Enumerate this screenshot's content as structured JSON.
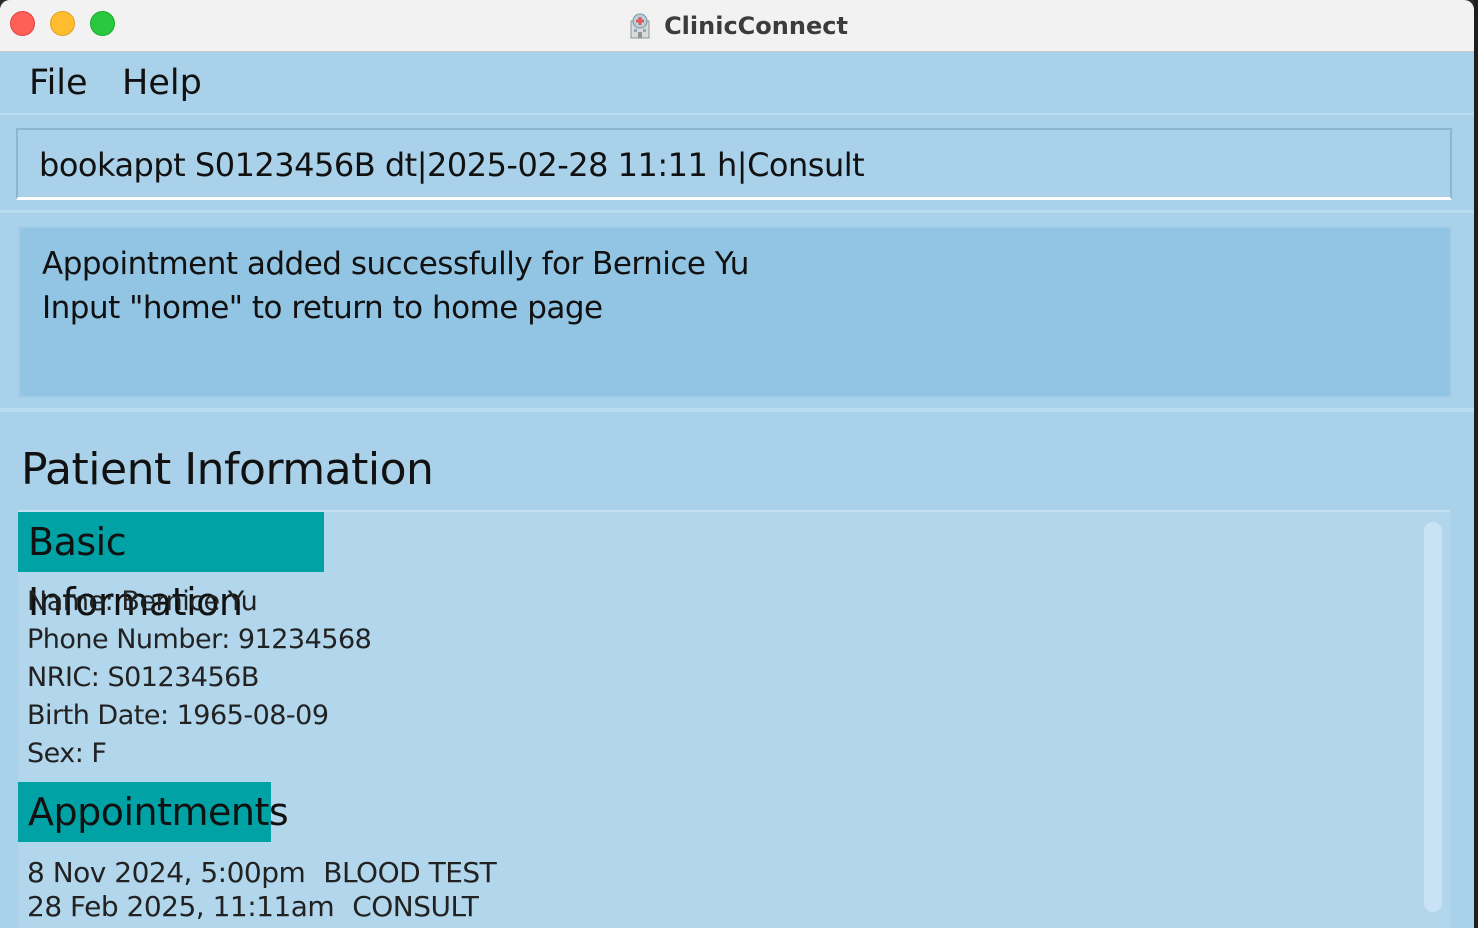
{
  "window": {
    "title": "ClinicConnect",
    "app_icon": "hospital-icon"
  },
  "menubar": {
    "items": [
      {
        "label": "File"
      },
      {
        "label": "Help"
      }
    ]
  },
  "command_box": {
    "value": "bookappt S0123456B dt|2025-02-28 11:11 h|Consult"
  },
  "result_display": {
    "lines": [
      "Appointment added successfully for Bernice Yu",
      "Input \"home\" to return to home page"
    ]
  },
  "patient_info": {
    "title": "Patient Information",
    "basic_header": "Basic Information",
    "fields": {
      "name": "Name: Bernice Yu",
      "phone": "Phone Number: 91234568",
      "nric": "NRIC: S0123456B",
      "birth_date": "Birth Date: 1965-08-09",
      "sex": "Sex: F"
    },
    "appointments_header": "Appointments",
    "appointments": [
      {
        "datetime": "8 Nov 2024, 5:00pm",
        "type": "BLOOD TEST"
      },
      {
        "datetime": "28 Feb 2025, 11:11am",
        "type": "CONSULT"
      }
    ]
  },
  "colors": {
    "background": "#a9d1ea",
    "result_background": "#92c4e4",
    "panel_background": "#b2d6ec",
    "header_accent": "#00a2a6"
  }
}
